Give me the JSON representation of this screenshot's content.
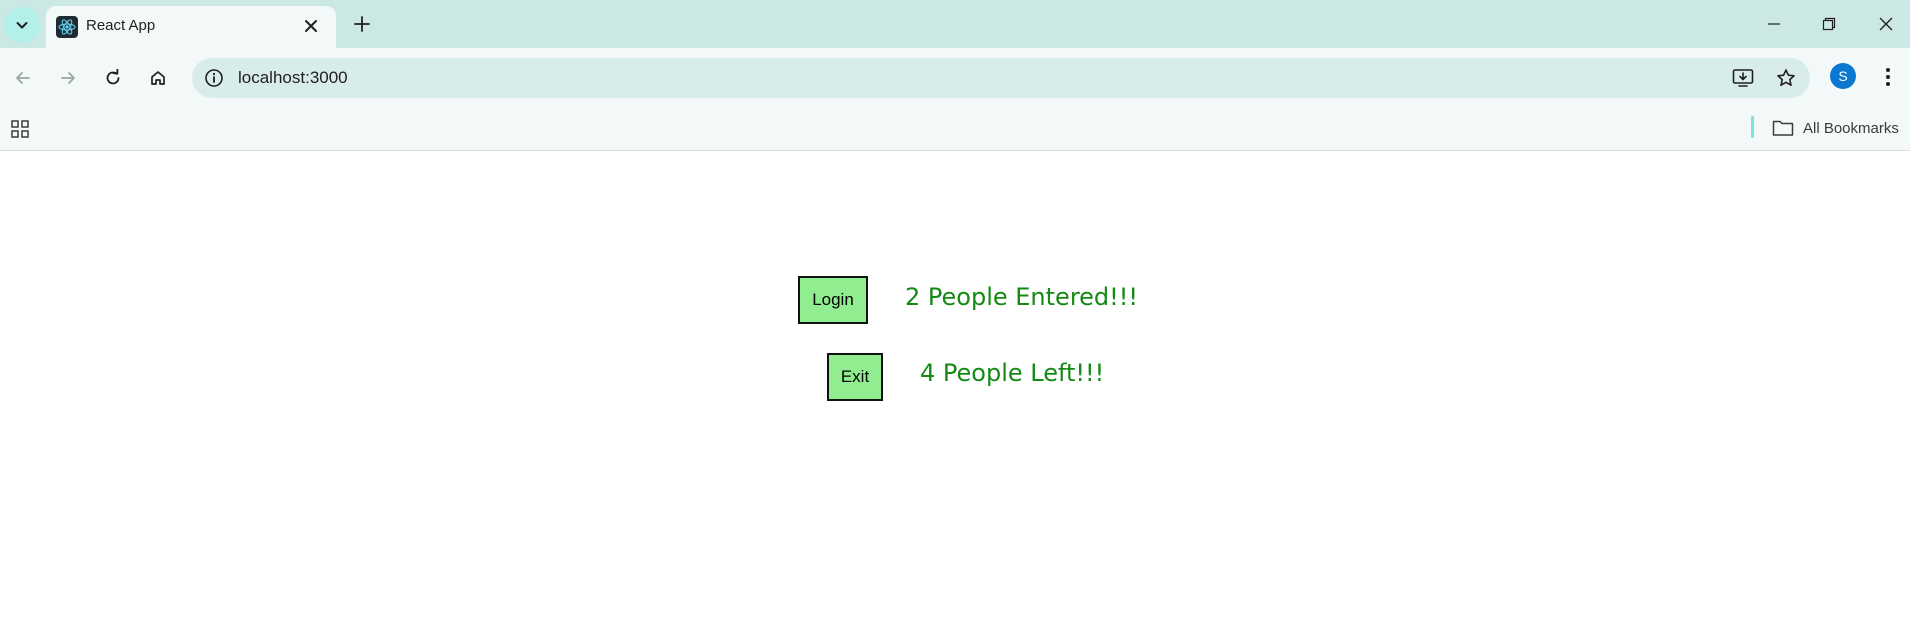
{
  "browser": {
    "tab": {
      "title": "React App",
      "favicon": "react-logo-icon"
    },
    "address_bar": {
      "url": "localhost:3000"
    },
    "profile": {
      "initial": "S",
      "color": "#0b78d0"
    },
    "bookmarks": {
      "all_label": "All Bookmarks"
    }
  },
  "app": {
    "login": {
      "button_label": "Login",
      "message": "2 People Entered!!!"
    },
    "exit": {
      "button_label": "Exit",
      "message": "4 People Left!!!"
    },
    "colors": {
      "button_bg": "#90ee90",
      "message_text": "#148a14"
    }
  }
}
